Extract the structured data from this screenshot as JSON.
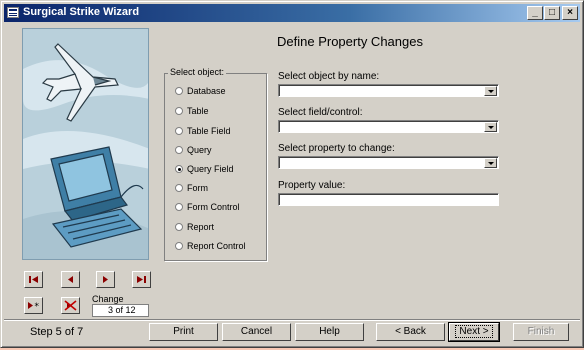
{
  "window": {
    "title": "Surgical Strike Wizard",
    "minimize": "_",
    "maximize": "□",
    "close": "×"
  },
  "heading": "Define Property Changes",
  "object_group": {
    "legend": "Select object:",
    "options": [
      {
        "label": "Database",
        "selected": false
      },
      {
        "label": "Table",
        "selected": false
      },
      {
        "label": "Table Field",
        "selected": false
      },
      {
        "label": "Query",
        "selected": false
      },
      {
        "label": "Query Field",
        "selected": true
      },
      {
        "label": "Form",
        "selected": false
      },
      {
        "label": "Form Control",
        "selected": false
      },
      {
        "label": "Report",
        "selected": false
      },
      {
        "label": "Report Control",
        "selected": false
      }
    ]
  },
  "fields": {
    "object_label": "Select object by name:",
    "object_value": "",
    "field_label": "Select field/control:",
    "field_value": "",
    "property_label": "Select property to change:",
    "property_value": "",
    "value_label": "Property value:",
    "value_value": ""
  },
  "navigator": {
    "change_label": "Change",
    "change_value": "3 of 12"
  },
  "footer": {
    "step": "Step 5 of 7",
    "print": "Print",
    "cancel": "Cancel",
    "help": "Help",
    "back": "< Back",
    "next": "Next >",
    "finish": "Finish"
  }
}
